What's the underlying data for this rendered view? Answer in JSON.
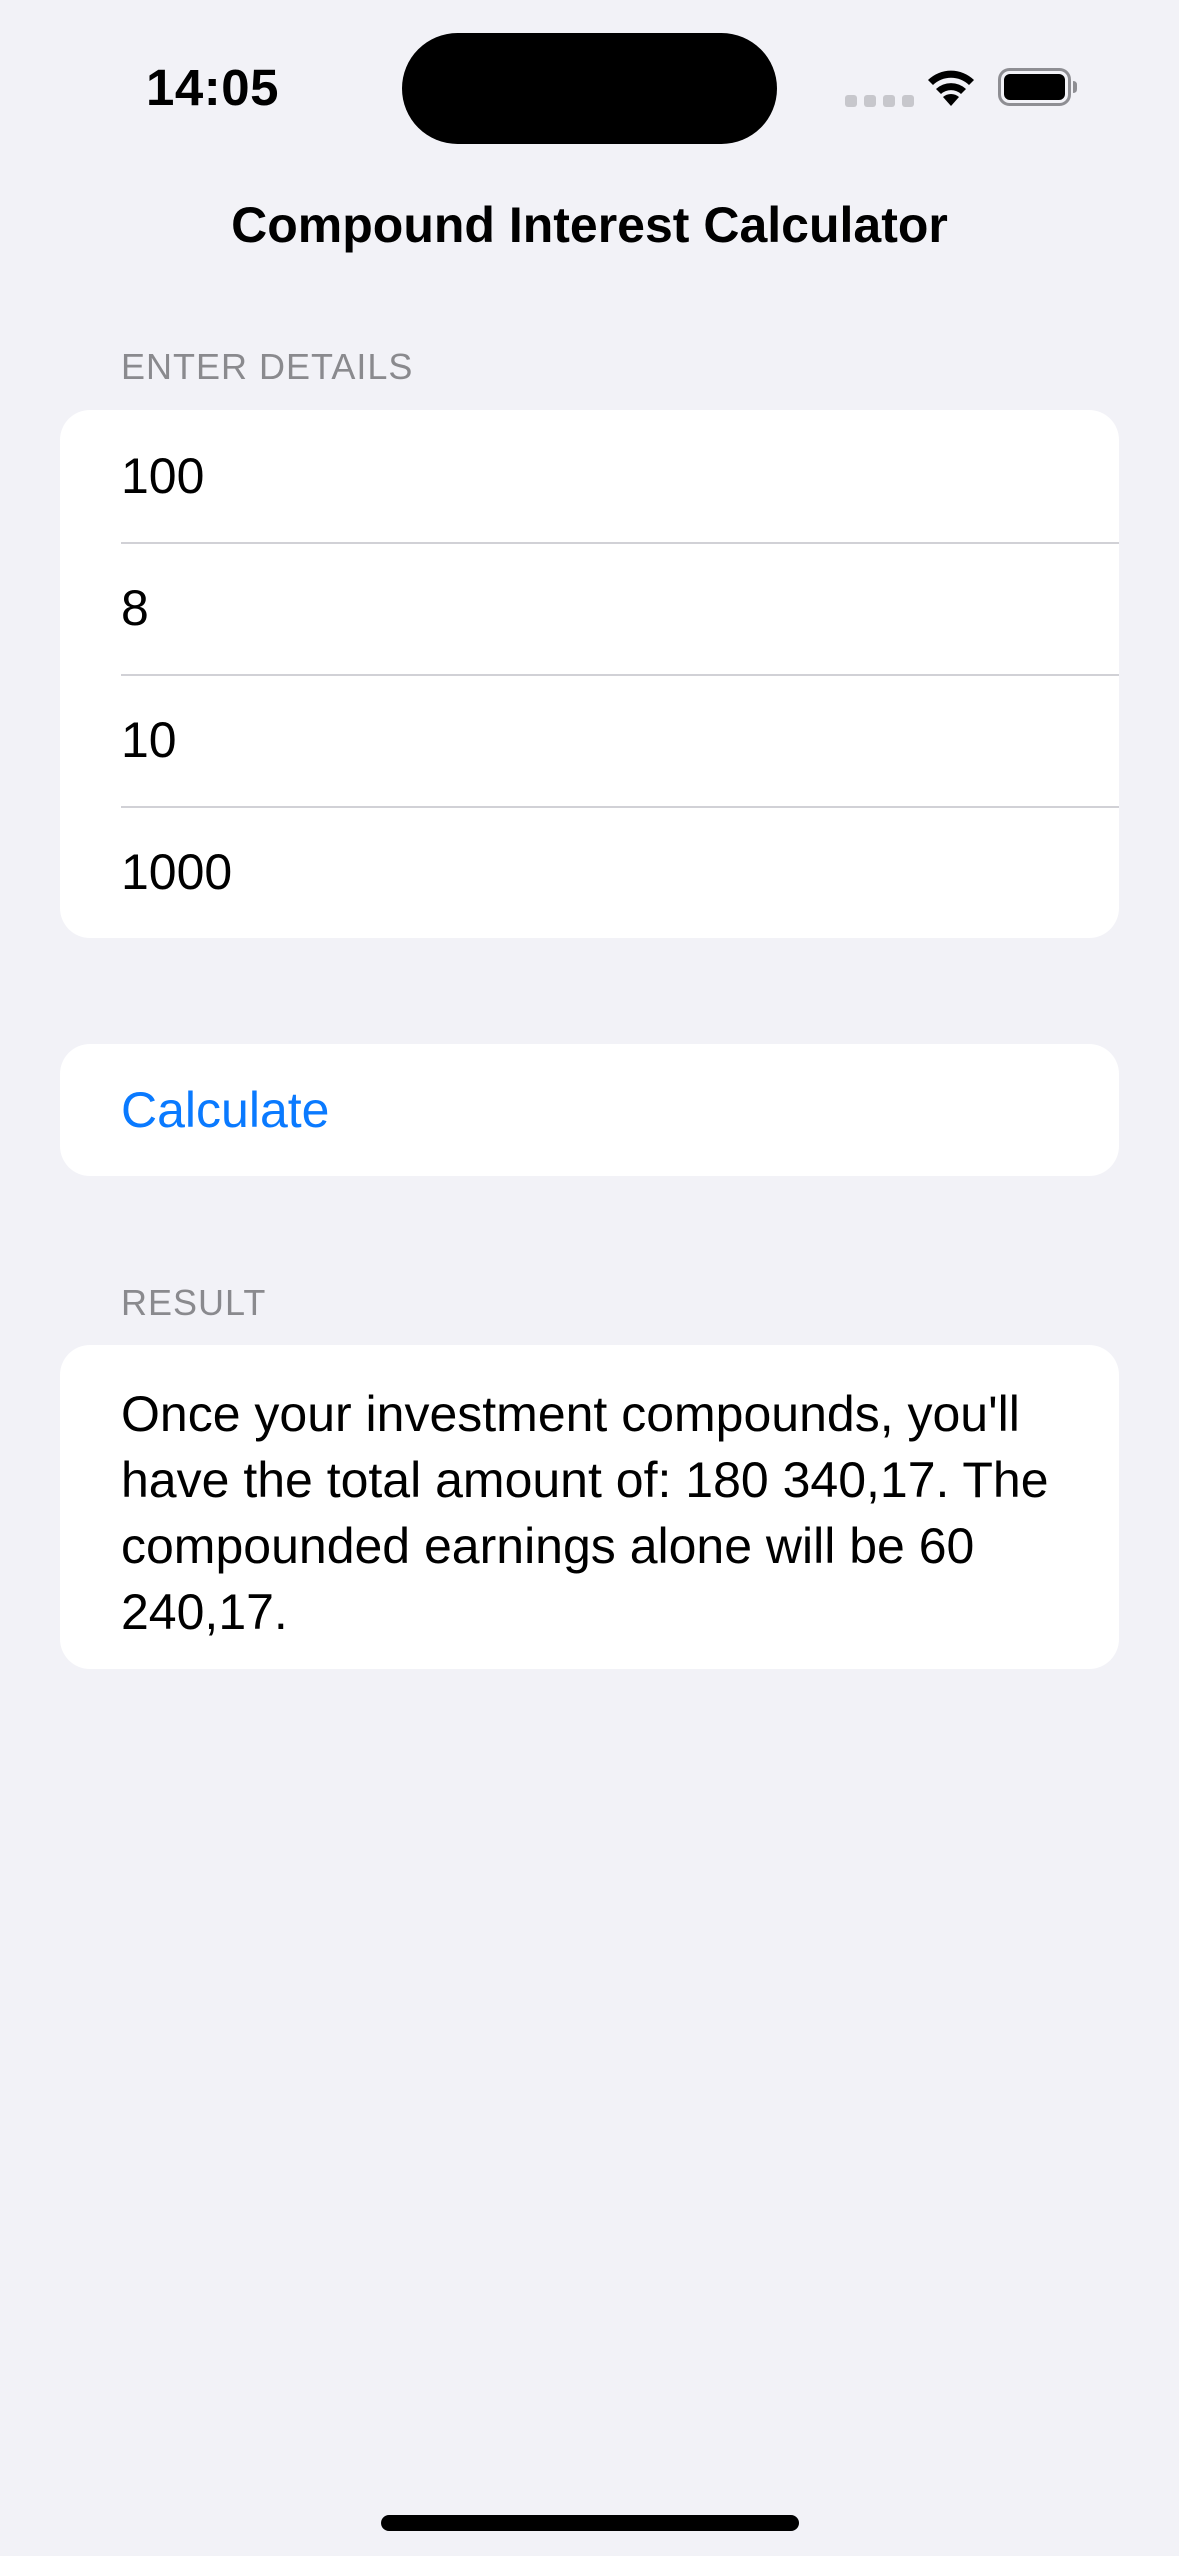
{
  "status_bar": {
    "time": "14:05"
  },
  "nav": {
    "title": "Compound Interest Calculator"
  },
  "details_section": {
    "header": "ENTER DETAILS",
    "fields": [
      {
        "value": "100"
      },
      {
        "value": "8"
      },
      {
        "value": "10"
      },
      {
        "value": "1000"
      }
    ]
  },
  "actions": {
    "calculate_label": "Calculate"
  },
  "result_section": {
    "header": "RESULT",
    "text": "Once your investment compounds, you'll have the total amount of: 180 340,17. The compounded earnings alone will be 60 240,17."
  },
  "colors": {
    "background": "#f2f2f7",
    "accent": "#0a7aff",
    "section_header": "#8a8a8e"
  },
  "icons": [
    "cellular-signal-icon",
    "wifi-icon",
    "battery-icon"
  ]
}
